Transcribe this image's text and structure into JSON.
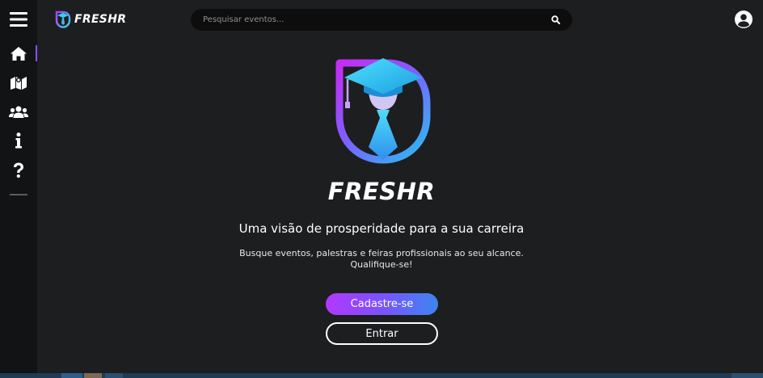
{
  "app": {
    "brand": "FRESHR"
  },
  "header": {
    "search": {
      "placeholder": "Pesquisar eventos..."
    },
    "search_icon": "search-icon",
    "user_icon": "user-circle-icon"
  },
  "sidebar": {
    "menu_icon": "hamburger-menu-icon",
    "items": [
      {
        "icon": "home-icon",
        "active": true
      },
      {
        "icon": "map-icon",
        "active": false
      },
      {
        "icon": "users-icon",
        "active": false
      },
      {
        "icon": "info-icon",
        "active": false
      },
      {
        "icon": "question-icon",
        "active": false
      }
    ]
  },
  "hero": {
    "title": "FRESHR",
    "tagline": "Uma visão de prosperidade para a sua carreira",
    "description_line1": "Busque eventos, palestras e feiras profissionais ao seu alcance.",
    "description_line2": "Qualifique-se!",
    "signup_label": "Cadastre-se",
    "login_label": "Entrar"
  },
  "colors": {
    "accent_purple": "#b238ff",
    "accent_blue": "#3c86f0",
    "accent_cyan": "#2fd6e8",
    "background": "#1d1e20",
    "sidebar": "#121315"
  }
}
